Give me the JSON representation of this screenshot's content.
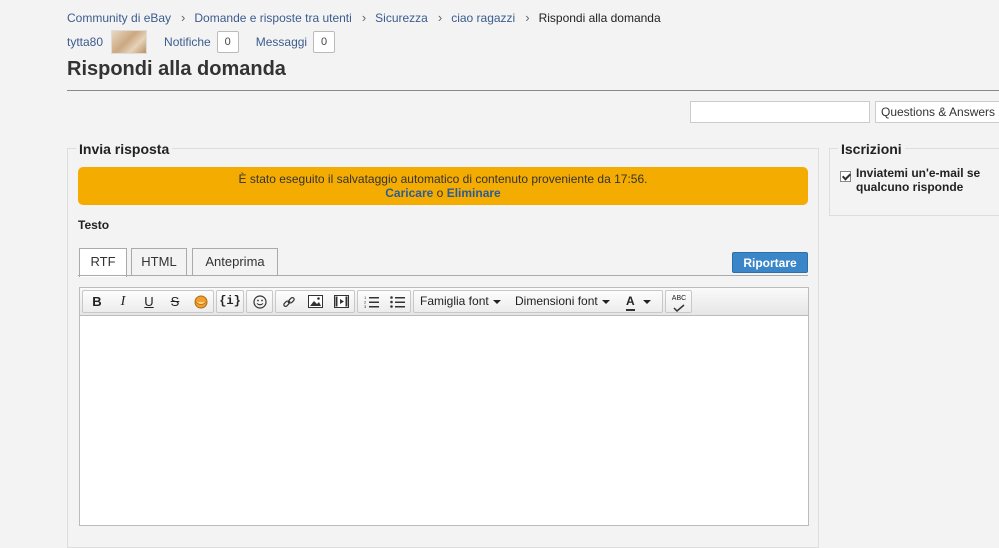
{
  "breadcrumb": {
    "items": [
      "Community di eBay",
      "Domande e risposte tra utenti",
      "Sicurezza",
      "ciao ragazzi"
    ],
    "current": "Rispondi alla domanda"
  },
  "user": {
    "username": "tytta80",
    "notifications_label": "Notifiche",
    "notifications_count": "0",
    "messages_label": "Messaggi",
    "messages_count": "0"
  },
  "page": {
    "title": "Rispondi alla domanda"
  },
  "search": {
    "value": "",
    "scope": "Questions & Answers"
  },
  "reply": {
    "section_title": "Invia risposta",
    "autosave_message": "È stato eseguito il salvataggio automatico di contenuto proveniente da 17:56.",
    "load_link": "Caricare",
    "or_text": "o",
    "delete_link": "Eliminare",
    "body_label": "Testo",
    "tabs": [
      "RTF",
      "HTML",
      "Anteprima"
    ],
    "report_button": "Riportare",
    "toolbar": {
      "bold": "B",
      "italic": "I",
      "underline": "U",
      "strike": "S",
      "code": "{i}",
      "font_family": "Famiglia font",
      "font_size": "Dimensioni font",
      "text_color": "A",
      "spellcheck": "ABC"
    }
  },
  "subscriptions": {
    "title": "Iscrizioni",
    "email_option": "Inviatemi un'e-mail se qualcuno risponde",
    "email_checked": true
  },
  "icons": [
    "chevron-right-icon",
    "bold-icon",
    "italic-icon",
    "underline-icon",
    "strikethrough-icon",
    "spoiler-icon",
    "code-icon",
    "emoji-icon",
    "link-icon",
    "image-icon",
    "video-icon",
    "numbered-list-icon",
    "bullet-list-icon",
    "text-color-icon",
    "spellcheck-icon",
    "checkbox-icon"
  ],
  "colors": {
    "link": "#3c5c8e",
    "autosave_bg": "#f5ac00",
    "report_button": "#3a86c8"
  }
}
